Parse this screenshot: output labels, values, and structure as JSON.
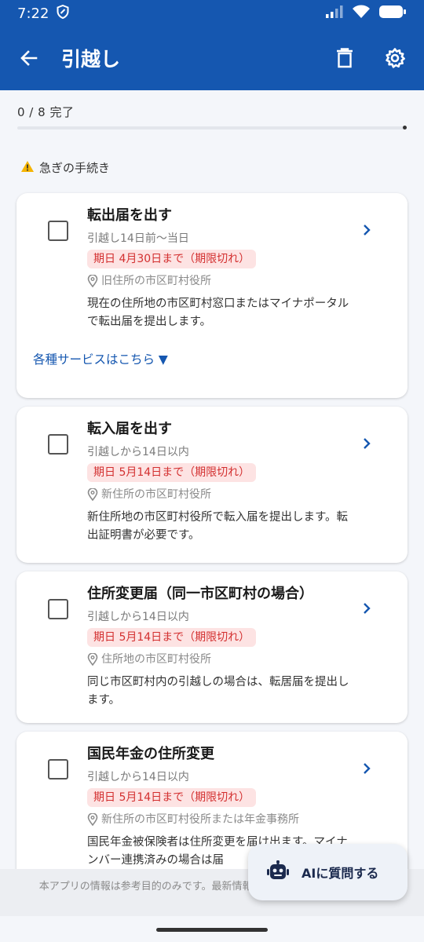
{
  "status_bar": {
    "time": "7:22"
  },
  "app_bar": {
    "title": "引越し"
  },
  "progress": {
    "label": "0 / 8 完了",
    "fraction": 0
  },
  "section": {
    "title": "急ぎの手続き"
  },
  "tasks": [
    {
      "title": "転出届を出す",
      "period": "引越し14日前〜当日",
      "deadline": "期日 4月30日まで（期限切れ）",
      "place": "旧住所の市区町村役所",
      "description": "現在の住所地の市区町村窓口またはマイナポータルで転出届を提出します。",
      "services_label": "各種サービスはこちら ▼"
    },
    {
      "title": "転入届を出す",
      "period": "引越しから14日以内",
      "deadline": "期日 5月14日まで（期限切れ）",
      "place": "新住所の市区町村役所",
      "description": "新住所地の市区町村役所で転入届を提出します。転出証明書が必要です。"
    },
    {
      "title": "住所変更届（同一市区町村の場合）",
      "period": "引越しから14日以内",
      "deadline": "期日 5月14日まで（期限切れ）",
      "place": "住所地の市区町村役所",
      "description": "同じ市区町村内の引越しの場合は、転居届を提出します。"
    },
    {
      "title": "国民年金の住所変更",
      "period": "引越しから14日以内",
      "deadline": "期日 5月14日まで（期限切れ）",
      "place": "新住所の市区町村役所または年金事務所",
      "description": "国民年金被保険者は住所変更を届け出ます。マイナンバー連携済みの場合は届"
    }
  ],
  "disclaimer": "本アプリの情報は参考目的のみです。最新情報は各機関にご確認ください。",
  "fab": {
    "label": "AIに質問する"
  },
  "colors": {
    "primary": "#1557b0",
    "danger": "#d32f2f",
    "danger_bg": "#fde3e3"
  }
}
